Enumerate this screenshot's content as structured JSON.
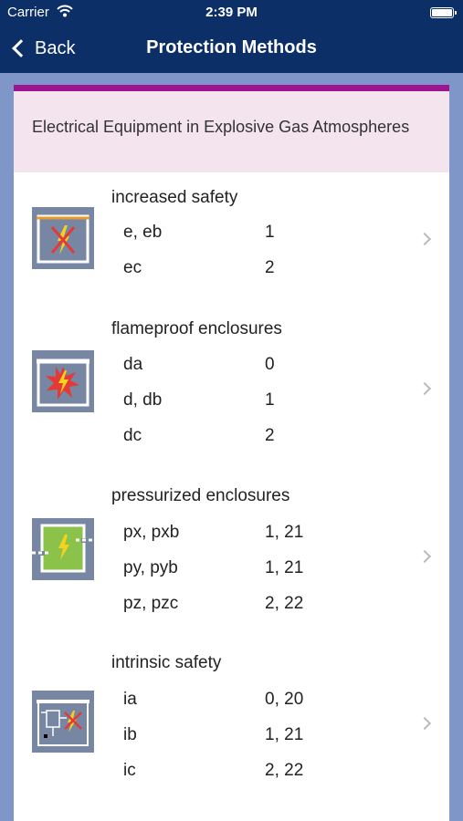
{
  "status": {
    "carrier": "Carrier",
    "time": "2:39 PM"
  },
  "nav": {
    "back_label": "Back",
    "title": "Protection Methods"
  },
  "section_title": "Electrical Equipment in Explosive Gas Atmospheres",
  "methods": [
    {
      "name": "increased safety",
      "icon": "increased-safety-icon",
      "rows": [
        {
          "code": "e, eb",
          "zone": "1"
        },
        {
          "code": "ec",
          "zone": "2"
        }
      ]
    },
    {
      "name": "flameproof enclosures",
      "icon": "flameproof-enclosure-icon",
      "rows": [
        {
          "code": "da",
          "zone": "0"
        },
        {
          "code": "d, db",
          "zone": "1"
        },
        {
          "code": "dc",
          "zone": "2"
        }
      ]
    },
    {
      "name": "pressurized enclosures",
      "icon": "pressurized-enclosure-icon",
      "rows": [
        {
          "code": "px, pxb",
          "zone": "1, 21"
        },
        {
          "code": "py, pyb",
          "zone": "1, 21"
        },
        {
          "code": "pz, pzc",
          "zone": "2, 22"
        }
      ]
    },
    {
      "name": "intrinsic safety",
      "icon": "intrinsic-safety-icon",
      "rows": [
        {
          "code": "ia",
          "zone": "0, 20"
        },
        {
          "code": "ib",
          "zone": "1, 21"
        },
        {
          "code": "ic",
          "zone": "2, 22"
        }
      ]
    }
  ],
  "colors": {
    "nav_background": "#0b2f66",
    "accent_bar": "#9d168f",
    "header_background": "#f4e4ee",
    "page_background": "#7f97c8",
    "icon_background": "#7786a3"
  }
}
